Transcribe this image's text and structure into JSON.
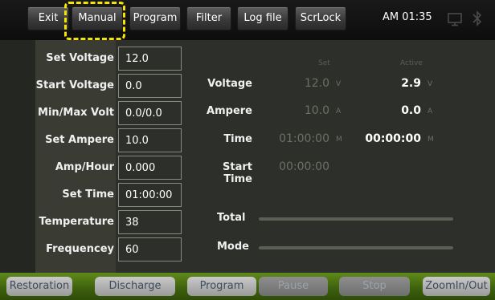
{
  "toolbar": {
    "exit": "Exit",
    "manual": "Manual",
    "program": "Program",
    "filter": "Filter",
    "log_file": "Log file",
    "scrlock": "ScrLock",
    "clock": "AM 01:35"
  },
  "settings": [
    {
      "label": "Set Voltage",
      "value": "12.0"
    },
    {
      "label": "Start Voltage",
      "value": "0.0"
    },
    {
      "label": "Min/Max Volt",
      "value": "0.0/0.0"
    },
    {
      "label": "Set Ampere",
      "value": "10.0"
    },
    {
      "label": "Amp/Hour",
      "value": "0.000"
    },
    {
      "label": "Set Time",
      "value": "01:00:00"
    },
    {
      "label": "Temperature",
      "value": "38"
    },
    {
      "label": "Frequencey",
      "value": "60"
    }
  ],
  "monitor": {
    "header_set": "Set",
    "header_active": "Active",
    "voltage": {
      "label": "Voltage",
      "set": "12.0",
      "set_unit": "V",
      "active": "2.9",
      "active_unit": "V"
    },
    "ampere": {
      "label": "Ampere",
      "set": "10.0",
      "set_unit": "A",
      "active": "0.0",
      "active_unit": "A"
    },
    "time": {
      "label": "Time",
      "set": "01:00:00",
      "set_unit": "M",
      "active": "00:00:00",
      "active_unit": "M"
    },
    "start_time": {
      "label": "Start Time",
      "set": "00:00:00"
    },
    "total": {
      "label": "Total",
      "progress": 0
    },
    "mode": {
      "label": "Mode",
      "progress": 0
    }
  },
  "bottom": {
    "restoration": "Restoration",
    "discharge": "Discharge",
    "program": "Program",
    "pause": "Pause",
    "stop": "Stop",
    "zoom": "ZoomIn/Out"
  },
  "colors": {
    "highlight": "#f4e600",
    "bottom_bar": "#4a7010"
  }
}
